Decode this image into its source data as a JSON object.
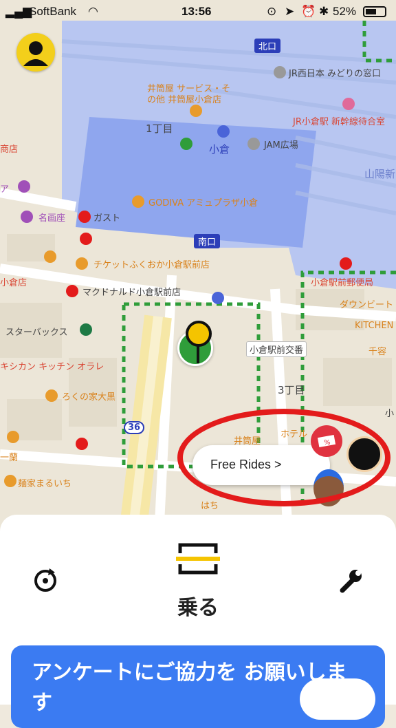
{
  "status_bar": {
    "carrier": "SoftBank",
    "time": "13:56",
    "battery": "52%",
    "icons": [
      "signal-icon",
      "wifi-icon",
      "lock-rotation-icon",
      "location-icon",
      "alarm-icon",
      "bluetooth-icon",
      "battery-icon"
    ]
  },
  "map": {
    "labels": {
      "north_exit": "北口",
      "jr_west": "JR西日本 みどりの窓口",
      "izutsuya_service": "井筒屋 サービス・そ",
      "izutsuya_service2": "の他 井筒屋小倉店",
      "chome1": "1丁目",
      "jr_waiting": "JR小倉駅 新幹線待合室",
      "kokura": "小倉",
      "jam": "JAM広場",
      "sanyo": "山陽新",
      "godiva": "GODIVA アミュプラザ小倉",
      "meigaza": "名画座",
      "gusto": "ガスト",
      "south_exit": "南口",
      "ticket": "チケットふくおか小倉駅前店",
      "mcd": "マクドナルド小倉駅前店",
      "post": "小倉駅前郵便局",
      "downbeat": "ダウンビート",
      "kitchen": "KITCHEN",
      "chiyo": "千容",
      "starbucks": "スターバックス",
      "police": "小倉駅前交番",
      "chome3": "3丁目",
      "kitchen_orale": "キシカン キッチン オラレ",
      "rokuno": "ろくの家大黒",
      "ichiran": "一蘭",
      "menya": "麺家まるいち",
      "izutsuya": "井筒屋",
      "hotel": "ホテル",
      "left_shop": "小倉店",
      "left_a": "ア",
      "left_ten": "商店",
      "route_36": "36",
      "hana": "はち",
      "sho": "小"
    }
  },
  "free_rides": {
    "label": "Free Rides >"
  },
  "sheet": {
    "ride_label": "乗る",
    "banner_text": "アンケートにご協力を お願いします"
  },
  "colors": {
    "accent": "#f5c400",
    "banner": "#3b7bf2",
    "highlight": "#e31b1b",
    "station": "#8fa6ee",
    "zone": "#2f9d3a"
  }
}
